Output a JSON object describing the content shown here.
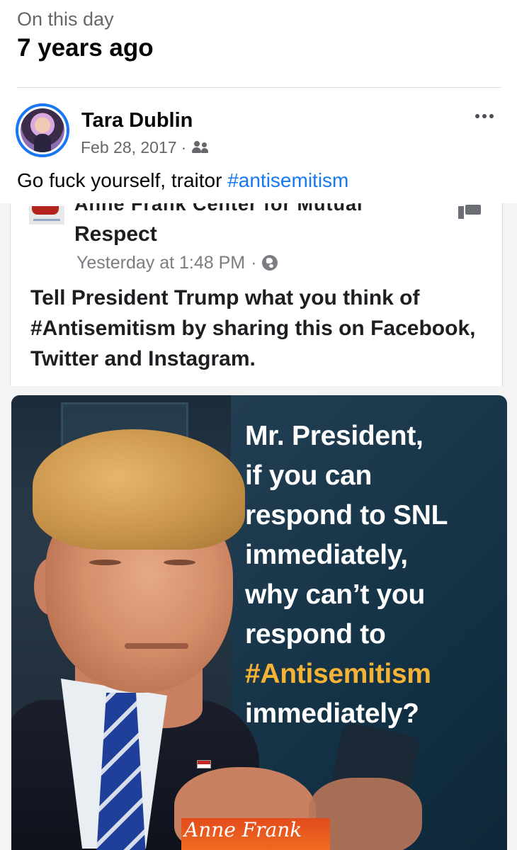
{
  "memory": {
    "kicker": "On this day",
    "title": "7 years ago"
  },
  "post": {
    "author": "Tara Dublin",
    "date": "Feb 28, 2017",
    "separator": "·",
    "audience_icon": "friends-icon",
    "text": "Go fuck yourself, traitor",
    "hashtag": "#antisemitism",
    "more_icon": "more-options-icon"
  },
  "shared_post": {
    "page_name_cut": "Anne Frank Center for Mutual",
    "page_name_rest": "Respect",
    "timestamp": "Yesterday at 1:48 PM",
    "separator": "·",
    "audience_icon": "globe-icon",
    "text": "Tell President Trump what you think of #Antisemitism by sharing this on Facebook, Twitter and Instagram."
  },
  "meme": {
    "line1": "Mr. President,",
    "line2": "if you can",
    "line3": "respond to SNL",
    "line4": "immediately,",
    "line5": "why can’t you",
    "line6": "respond to",
    "hashtag": "#Antisemitism",
    "line8": "immediately?",
    "logo_text": "Anne Frank"
  },
  "colors": {
    "link": "#1877f2",
    "meme_hashtag": "#f5b335",
    "logo_banner": "#e24c1d"
  }
}
